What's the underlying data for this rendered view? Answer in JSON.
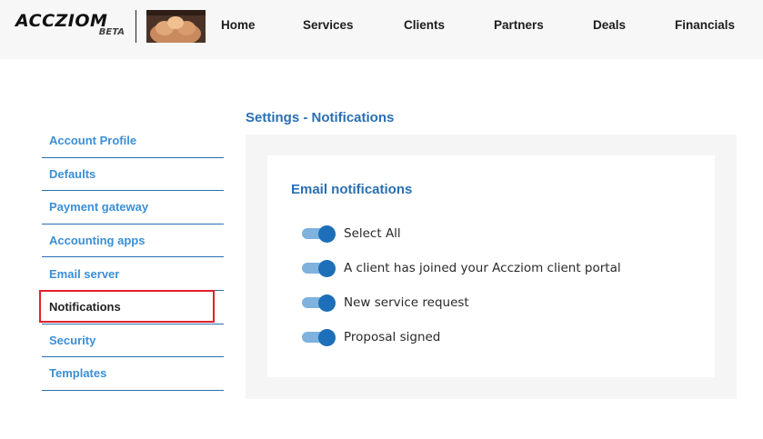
{
  "header": {
    "logo_text": "ACCZIOM",
    "logo_badge": "BETA",
    "photo_icon": "company-photo",
    "nav": [
      "Home",
      "Services",
      "Clients",
      "Partners",
      "Deals",
      "Financials"
    ]
  },
  "sidebar": {
    "items": [
      {
        "label": "Account Profile"
      },
      {
        "label": "Defaults"
      },
      {
        "label": "Payment gateway"
      },
      {
        "label": "Accounting apps"
      },
      {
        "label": "Email server"
      },
      {
        "label": "Notifications"
      },
      {
        "label": "Security"
      },
      {
        "label": "Templates"
      }
    ],
    "active": "Notifications"
  },
  "main": {
    "title": "Settings - Notifications",
    "section_title": "Email notifications",
    "toggles": [
      {
        "label": "Select All",
        "on": true
      },
      {
        "label": "A client has joined your Accziom client portal",
        "on": true
      },
      {
        "label": "New service request",
        "on": true
      },
      {
        "label": "Proposal signed",
        "on": true
      }
    ]
  },
  "colors": {
    "accent": "#2a6fb3",
    "sidebar_link": "#3a8fd6",
    "toggle_knob": "#1c6fb8",
    "toggle_track": "#7fb2dc",
    "highlight": "#e0202a"
  }
}
